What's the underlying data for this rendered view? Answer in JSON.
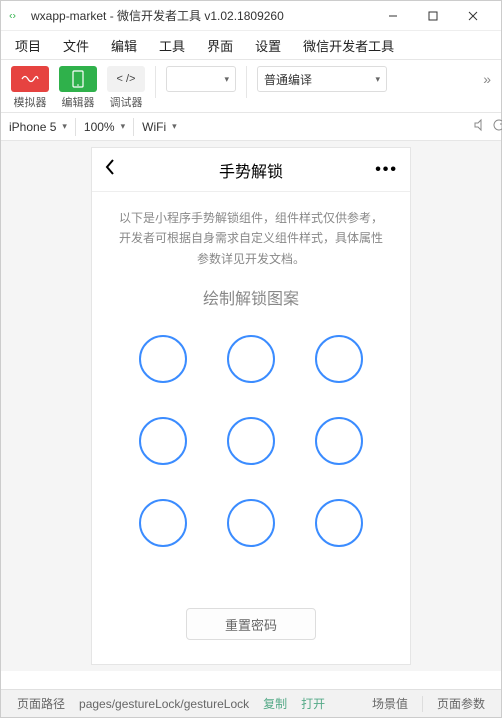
{
  "window": {
    "title": "wxapp-market - 微信开发者工具 v1.02.1809260"
  },
  "menu": {
    "items": [
      "项目",
      "文件",
      "编辑",
      "工具",
      "界面",
      "设置",
      "微信开发者工具"
    ]
  },
  "toolbar": {
    "simulator_label": "模拟器",
    "editor_label": "编辑器",
    "debugger_label": "调试器",
    "editor_icon_text": "< />",
    "blank_value": "",
    "compile_mode": "普通编译",
    "more": "»"
  },
  "devicebar": {
    "device": "iPhone 5",
    "zoom": "100%",
    "network": "WiFi"
  },
  "app": {
    "nav_title": "手势解锁",
    "description": "以下是小程序手势解锁组件，组件样式仅供参考，开发者可根据自身需求自定义组件样式，具体属性参数详见开发文档。",
    "heading": "绘制解锁图案",
    "reset_label": "重置密码",
    "menu_dots": "•••"
  },
  "statusbar": {
    "path_label": "页面路径",
    "path_value": "pages/gestureLock/gestureLock",
    "copy": "复制",
    "open": "打开",
    "scene": "场景值",
    "params": "页面参数"
  }
}
